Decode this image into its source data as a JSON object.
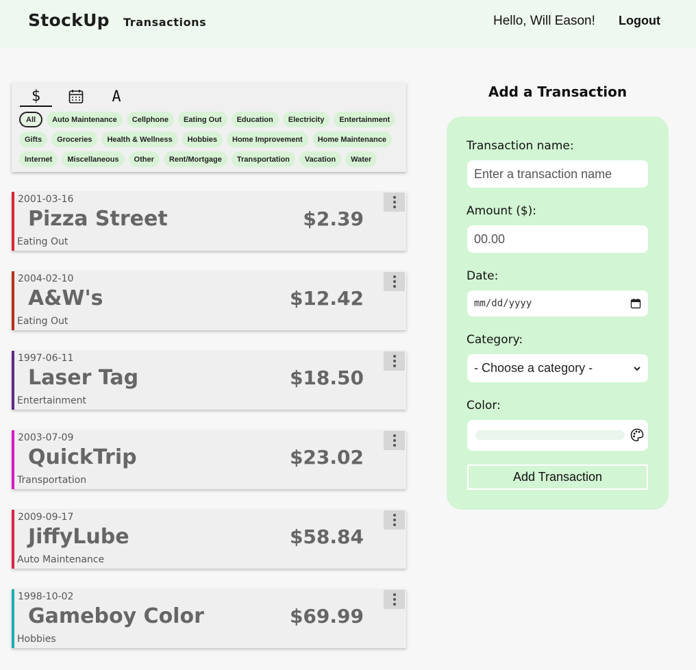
{
  "header": {
    "brand": "StockUp",
    "nav_transactions": "Transactions",
    "greeting": "Hello, Will Eason!",
    "logout": "Logout"
  },
  "filters": {
    "sort_tabs": [
      {
        "icon": "dollar-icon",
        "glyph": "$",
        "active": true
      },
      {
        "icon": "calendar-icon",
        "active": false
      },
      {
        "icon": "alphabet-icon",
        "glyph": "A",
        "active": false
      }
    ],
    "chip_rows": [
      [
        "All",
        "Auto Maintenance",
        "Cellphone",
        "Eating Out",
        "Education",
        "Electricity",
        "Entertainment"
      ],
      [
        "Gifts",
        "Groceries",
        "Health & Wellness",
        "Hobbies",
        "Home Improvement",
        "Home Maintenance"
      ],
      [
        "Internet",
        "Miscellaneous",
        "Other",
        "Rent/Mortgage",
        "Transportation",
        "Vacation",
        "Water"
      ]
    ],
    "selected": "All"
  },
  "transactions": [
    {
      "date": "2001-03-16",
      "name": "Pizza Street",
      "amount": "$2.39",
      "category": "Eating Out",
      "color": "#d9263b"
    },
    {
      "date": "2004-02-10",
      "name": "A&W's",
      "amount": "$12.42",
      "category": "Eating Out",
      "color": "#b5311c"
    },
    {
      "date": "1997-06-11",
      "name": "Laser Tag",
      "amount": "$18.50",
      "category": "Entertainment",
      "color": "#5c2a86"
    },
    {
      "date": "2003-07-09",
      "name": "QuickTrip",
      "amount": "$23.02",
      "category": "Transportation",
      "color": "#d61cc8"
    },
    {
      "date": "2009-09-17",
      "name": "JiffyLube",
      "amount": "$58.84",
      "category": "Auto Maintenance",
      "color": "#d9264a"
    },
    {
      "date": "1998-10-02",
      "name": "Gameboy Color",
      "amount": "$69.99",
      "category": "Hobbies",
      "color": "#1faeae"
    }
  ],
  "form": {
    "title": "Add a Transaction",
    "name_label": "Transaction name:",
    "name_placeholder": "Enter a transaction name",
    "amount_label": "Amount ($):",
    "amount_placeholder": "00.00",
    "date_label": "Date:",
    "date_placeholder": "mm/dd/yyyy",
    "category_label": "Category:",
    "category_value": "- Choose a category -",
    "color_label": "Color:",
    "submit_label": "Add Transaction"
  },
  "colors": {
    "header_bg": "#eef8ee",
    "panel_bg": "#d2f5d3",
    "chip_bg": "#d8f2d6"
  }
}
